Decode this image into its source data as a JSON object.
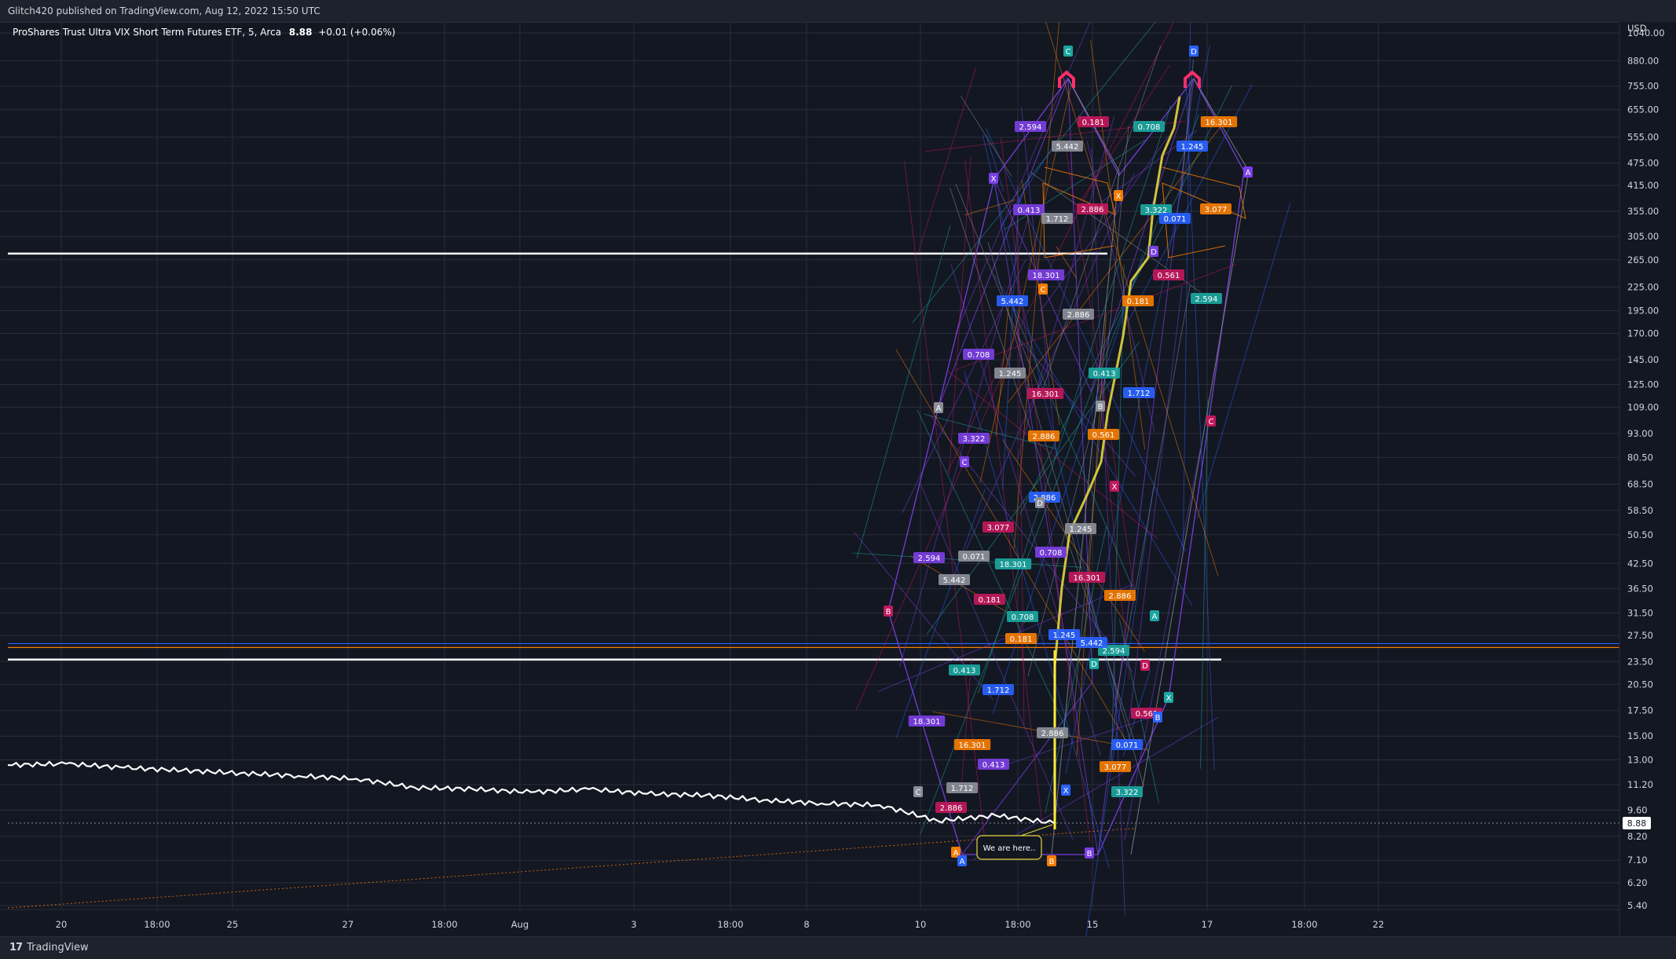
{
  "header": {
    "published": "Glitch420 published on TradingView.com, Aug 12, 2022 15:50 UTC"
  },
  "legend": {
    "symbol": "ProShares Trust Ultra VIX Short Term Futures ETF, 5, Arca",
    "price": "8.88",
    "change": "+0.01 (+0.06%)"
  },
  "footer": {
    "brand": "TradingView"
  },
  "annotation": {
    "text": "We are here.."
  },
  "colors": {
    "background": "#131722",
    "grid": "#2a2e39",
    "price_line": "#ffffff",
    "purple": "#7b3fe4",
    "gray": "#8c8f99",
    "teal": "#1aa6a0",
    "crimson": "#c2185b",
    "blue": "#2962ff",
    "orange": "#f57c00",
    "yellow": "#e5d63f",
    "pink": "#ff2d6b"
  },
  "chart_data": {
    "type": "line",
    "title": "ProShares Trust Ultra VIX Short Term Futures ETF, 5, Arca",
    "y_scale": "log",
    "y_unit": "USD",
    "y_ticks": [
      "1040.00",
      "880.00",
      "755.00",
      "655.00",
      "555.00",
      "475.00",
      "415.00",
      "355.00",
      "305.00",
      "265.00",
      "225.00",
      "195.00",
      "170.00",
      "145.00",
      "125.00",
      "109.00",
      "93.00",
      "80.50",
      "68.50",
      "58.50",
      "50.50",
      "42.50",
      "36.50",
      "31.50",
      "27.50",
      "23.50",
      "20.50",
      "17.50",
      "15.00",
      "13.00",
      "11.20",
      "9.60",
      "8.20",
      "7.10",
      "6.20",
      "5.40"
    ],
    "x_ticks": [
      "20",
      "18:00",
      "25",
      "27",
      "18:00",
      "Aug",
      "3",
      "18:00",
      "8",
      "10",
      "18:00",
      "15",
      "17",
      "18:00",
      "22"
    ],
    "last_price": "8.88",
    "price_series": {
      "name": "",
      "x": [
        "Jul 19",
        "Jul 20",
        "Jul 21",
        "Jul 22",
        "Jul 25",
        "Jul 26",
        "Jul 27",
        "Jul 28",
        "Jul 29",
        "Aug 1",
        "Aug 2",
        "Aug 3",
        "Aug 4",
        "Aug 5",
        "Aug 8",
        "Aug 9",
        "Aug 10",
        "Aug 11",
        "Aug 12"
      ],
      "y": [
        12.6,
        12.7,
        12.4,
        12.2,
        12.0,
        11.8,
        11.6,
        11.0,
        10.9,
        10.7,
        10.9,
        10.6,
        10.5,
        10.2,
        10.0,
        9.9,
        9.0,
        9.3,
        8.88
      ]
    },
    "horizontal_levels": [
      {
        "value": 275,
        "color": "#ffffff"
      },
      {
        "value": 23.8,
        "color": "#ffffff"
      },
      {
        "value": 26.2,
        "color": "#2962ff"
      },
      {
        "value": 25.6,
        "color": "#f57c00"
      },
      {
        "value": 8.88,
        "color": "#9598a1"
      }
    ],
    "pattern_labels": [
      "2.594",
      "5.442",
      "0.181",
      "0.708",
      "1.245",
      "16.301",
      "0.413",
      "1.712",
      "2.886",
      "3.322",
      "0.071",
      "3.077",
      "18.301",
      "2.886",
      "0.561",
      "X",
      "A",
      "B",
      "C",
      "D"
    ]
  }
}
